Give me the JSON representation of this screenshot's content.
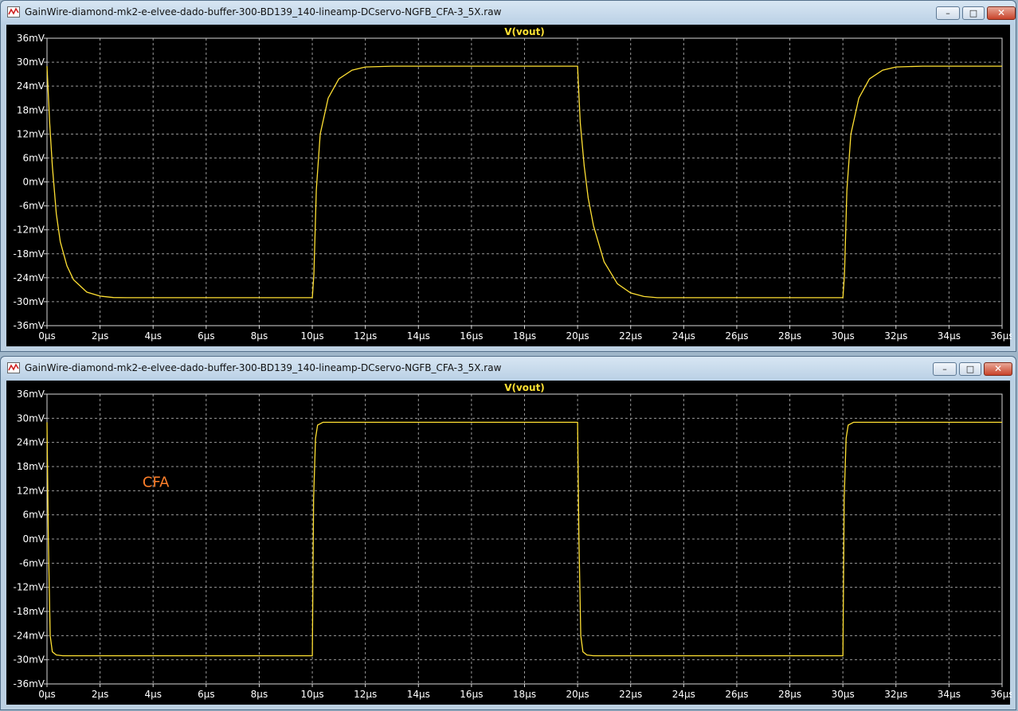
{
  "windows": [
    {
      "title": "GainWire-diamond-mk2-e-elvee-dado-buffer-300-BD139_140-lineamp-DCservo-NGFB_CFA-3_5X.raw",
      "buttons": {
        "minimize": "–",
        "maximize": "□",
        "close": "✕"
      },
      "chart_data": {
        "type": "line",
        "title": "V(vout)",
        "xlabel": "",
        "ylabel": "",
        "xlim": [
          0,
          36
        ],
        "ylim": [
          -36,
          36
        ],
        "x_ticks": [
          "0µs",
          "2µs",
          "4µs",
          "6µs",
          "8µs",
          "10µs",
          "12µs",
          "14µs",
          "16µs",
          "18µs",
          "20µs",
          "22µs",
          "24µs",
          "26µs",
          "28µs",
          "30µs",
          "32µs",
          "34µs",
          "36µs"
        ],
        "y_ticks": [
          "36mV",
          "30mV",
          "24mV",
          "18mV",
          "12mV",
          "6mV",
          "0mV",
          "-6mV",
          "-12mV",
          "-18mV",
          "-24mV",
          "-30mV",
          "-36mV"
        ],
        "grid": true,
        "series": [
          {
            "name": "V(vout)",
            "color": "#ffe033",
            "x_unit": "µs",
            "y_unit": "mV",
            "points": [
              [
                0,
                29
              ],
              [
                0.1,
                15
              ],
              [
                0.2,
                4
              ],
              [
                0.35,
                -8
              ],
              [
                0.5,
                -15
              ],
              [
                0.75,
                -21
              ],
              [
                1,
                -24.5
              ],
              [
                1.5,
                -27.6
              ],
              [
                2,
                -28.6
              ],
              [
                2.5,
                -28.95
              ],
              [
                3,
                -29
              ],
              [
                10,
                -29
              ],
              [
                10.06,
                -23
              ],
              [
                10.15,
                -2
              ],
              [
                10.3,
                12
              ],
              [
                10.6,
                21
              ],
              [
                11,
                25.8
              ],
              [
                11.5,
                28
              ],
              [
                12,
                28.8
              ],
              [
                13,
                29
              ],
              [
                20,
                29
              ],
              [
                20.1,
                15
              ],
              [
                20.25,
                4
              ],
              [
                20.4,
                -4
              ],
              [
                20.6,
                -11
              ],
              [
                21,
                -20
              ],
              [
                21.5,
                -25.5
              ],
              [
                22,
                -27.8
              ],
              [
                22.5,
                -28.7
              ],
              [
                23,
                -29
              ],
              [
                30,
                -29
              ],
              [
                30.06,
                -23
              ],
              [
                30.15,
                -2
              ],
              [
                30.3,
                12
              ],
              [
                30.6,
                21
              ],
              [
                31,
                25.8
              ],
              [
                31.5,
                28
              ],
              [
                32,
                28.8
              ],
              [
                33,
                29
              ],
              [
                36,
                29
              ]
            ]
          }
        ],
        "annotation": ""
      }
    },
    {
      "title": "GainWire-diamond-mk2-e-elvee-dado-buffer-300-BD139_140-lineamp-DCservo-NGFB_CFA-3_5X.raw",
      "buttons": {
        "minimize": "–",
        "maximize": "□",
        "close": "✕"
      },
      "chart_data": {
        "type": "line",
        "title": "V(vout)",
        "xlabel": "",
        "ylabel": "",
        "xlim": [
          0,
          36
        ],
        "ylim": [
          -36,
          36
        ],
        "x_ticks": [
          "0µs",
          "2µs",
          "4µs",
          "6µs",
          "8µs",
          "10µs",
          "12µs",
          "14µs",
          "16µs",
          "18µs",
          "20µs",
          "22µs",
          "24µs",
          "26µs",
          "28µs",
          "30µs",
          "32µs",
          "34µs",
          "36µs"
        ],
        "y_ticks": [
          "36mV",
          "30mV",
          "24mV",
          "18mV",
          "12mV",
          "6mV",
          "0mV",
          "-6mV",
          "-12mV",
          "-18mV",
          "-24mV",
          "-30mV",
          "-36mV"
        ],
        "grid": true,
        "series": [
          {
            "name": "V(vout)",
            "color": "#ffe033",
            "x_unit": "µs",
            "y_unit": "mV",
            "points": [
              [
                0,
                29
              ],
              [
                0.05,
                0
              ],
              [
                0.12,
                -24
              ],
              [
                0.2,
                -28
              ],
              [
                0.35,
                -28.8
              ],
              [
                0.6,
                -29
              ],
              [
                10,
                -29
              ],
              [
                10.05,
                10
              ],
              [
                10.12,
                25
              ],
              [
                10.2,
                28.3
              ],
              [
                10.4,
                29
              ],
              [
                20,
                29
              ],
              [
                20.05,
                0
              ],
              [
                20.12,
                -24
              ],
              [
                20.2,
                -28
              ],
              [
                20.35,
                -28.8
              ],
              [
                20.6,
                -29
              ],
              [
                30,
                -29
              ],
              [
                30.05,
                10
              ],
              [
                30.12,
                25
              ],
              [
                30.2,
                28.3
              ],
              [
                30.4,
                29
              ],
              [
                36,
                29
              ]
            ]
          }
        ],
        "annotation": "CFA",
        "annotation_color": "#ff7f2a"
      }
    }
  ]
}
